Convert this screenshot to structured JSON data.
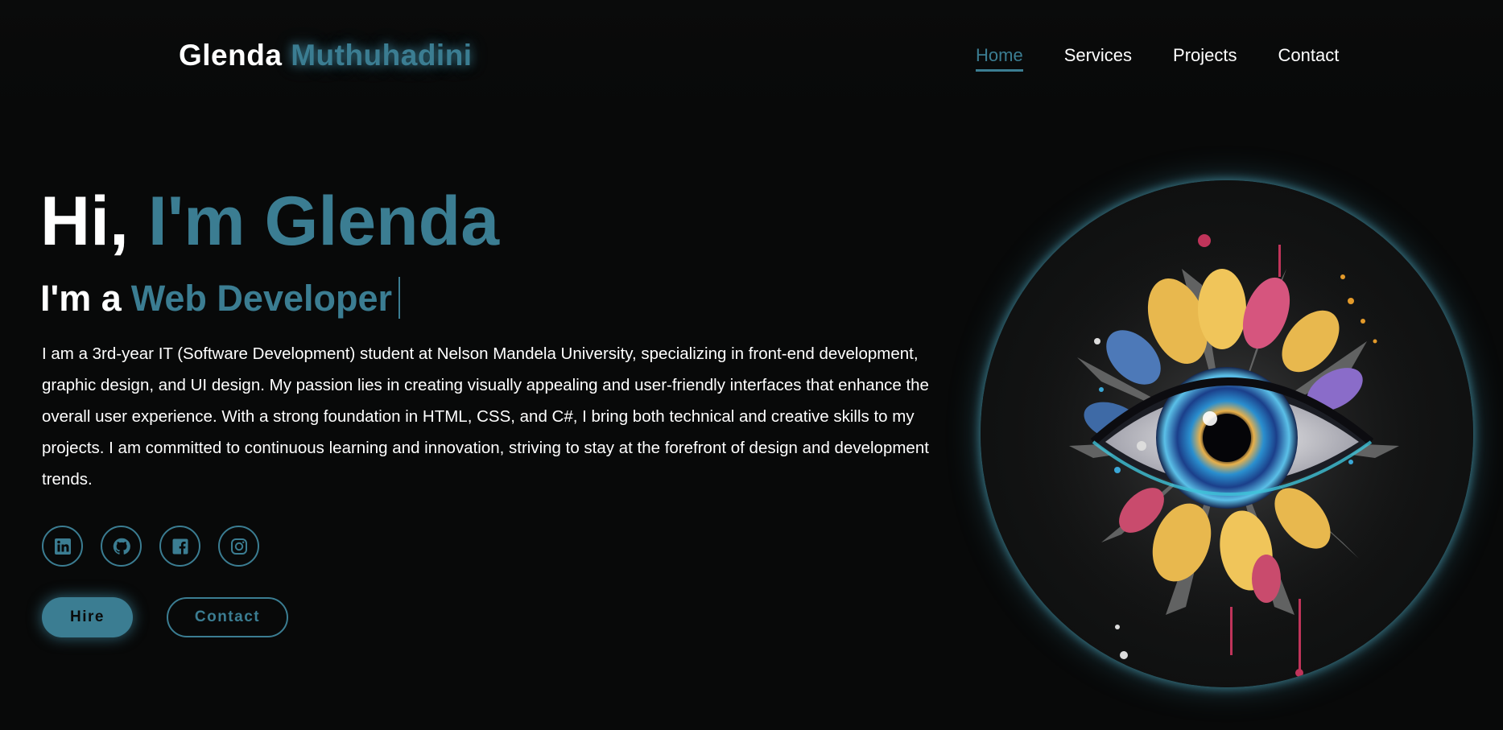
{
  "header": {
    "logo_first": "Glenda",
    "logo_last": "Muthuhadini",
    "nav": [
      {
        "label": "Home",
        "active": true
      },
      {
        "label": "Services",
        "active": false
      },
      {
        "label": "Projects",
        "active": false
      },
      {
        "label": "Contact",
        "active": false
      }
    ]
  },
  "hero": {
    "greeting": "Hi,",
    "name_highlight": "I'm Glenda",
    "role_prefix": "I'm a",
    "role_highlight": "Web Developer",
    "bio": "I am a 3rd-year IT (Software Development) student at Nelson Mandela University, specializing in front-end development, graphic design, and UI design. My passion lies in creating visually appealing and user-friendly interfaces that enhance the overall user experience. With a strong foundation in HTML, CSS, and C#, I bring both technical and creative skills to my projects. I am committed to continuous learning and innovation, striving to stay at the forefront of design and development trends."
  },
  "socials": [
    {
      "icon": "linkedin-icon"
    },
    {
      "icon": "github-icon"
    },
    {
      "icon": "facebook-icon"
    },
    {
      "icon": "instagram-icon"
    }
  ],
  "buttons": {
    "hire_label": "Hire",
    "contact_label": "Contact"
  },
  "colors": {
    "accent": "#3b7d92",
    "background": "#080909",
    "text": "#ffffff"
  }
}
